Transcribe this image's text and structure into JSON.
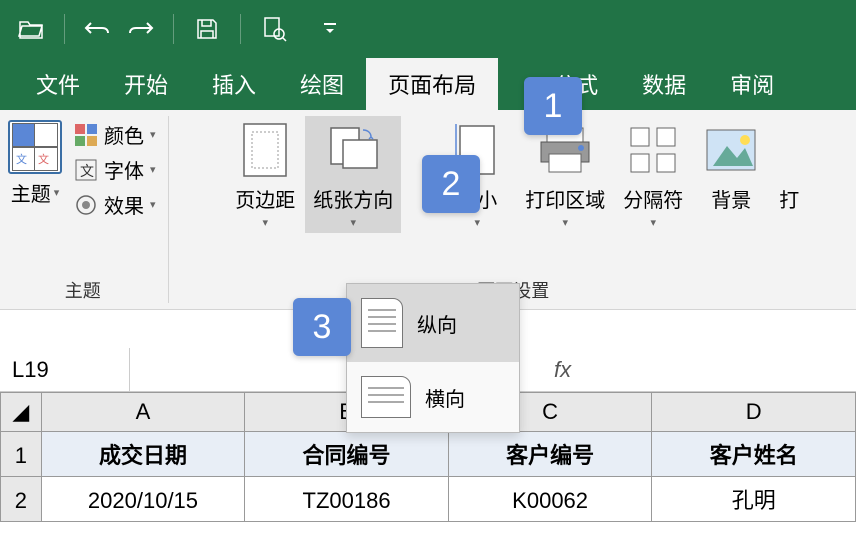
{
  "titlebar": {
    "icons": [
      "open",
      "undo",
      "redo",
      "save",
      "print-preview",
      "more"
    ]
  },
  "tabs": {
    "items": [
      "文件",
      "开始",
      "插入",
      "绘图",
      "页面布局",
      "公式",
      "数据",
      "审阅"
    ],
    "active_index": 4
  },
  "ribbon": {
    "groups": {
      "theme": {
        "label": "主题",
        "main": "主题",
        "color": "颜色",
        "font": "字体",
        "effect": "效果"
      },
      "page_setup": {
        "label": "页面设置",
        "margins": "页边距",
        "orientation": "纸张方向",
        "size": "大小",
        "print_area": "打印区域",
        "breaks": "分隔符",
        "background": "背景",
        "print_titles": "打"
      }
    }
  },
  "orientation_menu": {
    "portrait": "纵向",
    "landscape": "横向"
  },
  "callouts": {
    "c1": "1",
    "c2": "2",
    "c3": "3"
  },
  "name_box": "L19",
  "fx": "fx",
  "columns": [
    "A",
    "B",
    "C",
    "D"
  ],
  "rows": [
    "1",
    "2"
  ],
  "headers": [
    "成交日期",
    "合同编号",
    "客户编号",
    "客户姓名"
  ],
  "data_row": [
    "2020/10/15",
    "TZ00186",
    "K00062",
    "孔明"
  ]
}
